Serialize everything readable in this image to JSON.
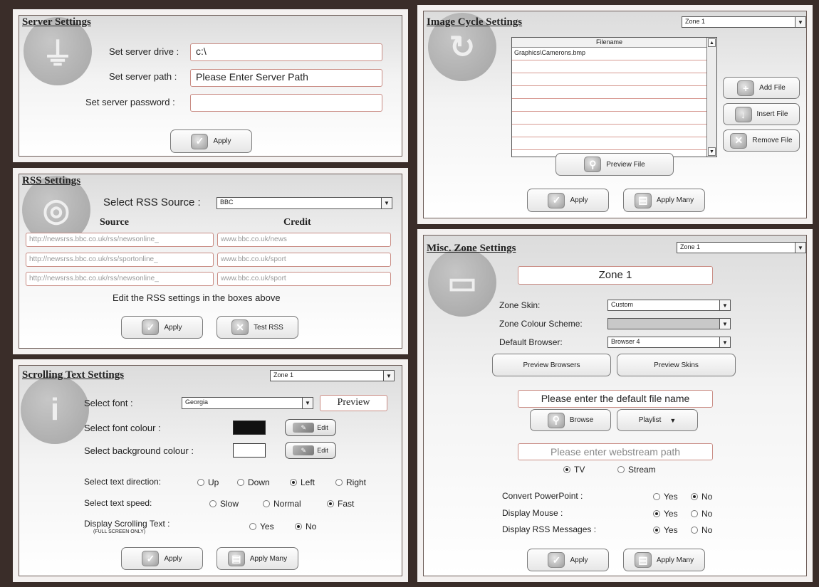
{
  "server": {
    "title": "Server Settings",
    "drive_label": "Set server drive :",
    "drive_value": "c:\\",
    "path_label": "Set server path :",
    "path_value": "Please Enter Server Path",
    "password_label": "Set server password :",
    "password_value": "",
    "apply": "Apply"
  },
  "rss": {
    "title": "RSS Settings",
    "source_label": "Select RSS Source :",
    "source_value": "BBC",
    "col_source": "Source",
    "col_credit": "Credit",
    "rows": [
      {
        "source": "http://newsrss.bbc.co.uk/rss/newsonline_",
        "credit": "www.bbc.co.uk/news"
      },
      {
        "source": "http://newsrss.bbc.co.uk/rss/sportonline_",
        "credit": "www.bbc.co.uk/sport"
      },
      {
        "source": "http://newsrss.bbc.co.uk/rss/newsonline_",
        "credit": "www.bbc.co.uk/sport"
      }
    ],
    "hint": "Edit the RSS settings in the boxes above",
    "apply": "Apply",
    "test": "Test RSS"
  },
  "scrolling": {
    "title": "Scrolling Text Settings",
    "zone": "Zone 1",
    "font_label": "Select font :",
    "font_value": "Georgia",
    "preview": "Preview",
    "font_colour_label": "Select font colour :",
    "bg_colour_label": "Select background colour :",
    "font_colour": "#111111",
    "bg_colour": "#ffffff",
    "edit": "Edit",
    "direction_label": "Select text direction:",
    "direction_options": [
      "Up",
      "Down",
      "Left",
      "Right"
    ],
    "speed_label": "Select text speed:",
    "speed_options": [
      "Slow",
      "Normal",
      "Fast"
    ],
    "display_label": "Display Scrolling Text :",
    "display_sub": "(FULL SCREEN ONLY)",
    "display_options": [
      "Yes",
      "No"
    ],
    "apply": "Apply",
    "apply_many": "Apply Many"
  },
  "image_cycle": {
    "title": "Image Cycle Settings",
    "zone": "Zone 1",
    "list_header": "Filename",
    "files": [
      "Graphics\\Camerons.bmp",
      "",
      "",
      "",
      "",
      "",
      "",
      ""
    ],
    "add": "Add File",
    "insert": "Insert File",
    "remove": "Remove File",
    "preview": "Preview File",
    "apply": "Apply",
    "apply_many": "Apply Many"
  },
  "misc": {
    "title": "Misc. Zone Settings",
    "zone": "Zone 1",
    "zone_name": "Zone 1",
    "skin_label": "Zone Skin:",
    "skin_value": "Custom",
    "colour_label": "Zone Colour Scheme:",
    "colour_value": "",
    "browser_label": "Default Browser:",
    "browser_value": "Browser 4",
    "preview_browsers": "Preview Browsers",
    "preview_skins": "Preview Skins",
    "default_file_placeholder": "Please enter the default file name",
    "browse": "Browse",
    "playlist": "Playlist",
    "webstream_placeholder": "Please enter webstream path",
    "stream_options": [
      "TV",
      "Stream"
    ],
    "convert_label": "Convert PowerPoint :",
    "mouse_label": "Display Mouse :",
    "rssmsg_label": "Display RSS Messages :",
    "yes": "Yes",
    "no": "No",
    "apply": "Apply",
    "apply_many": "Apply Many"
  }
}
